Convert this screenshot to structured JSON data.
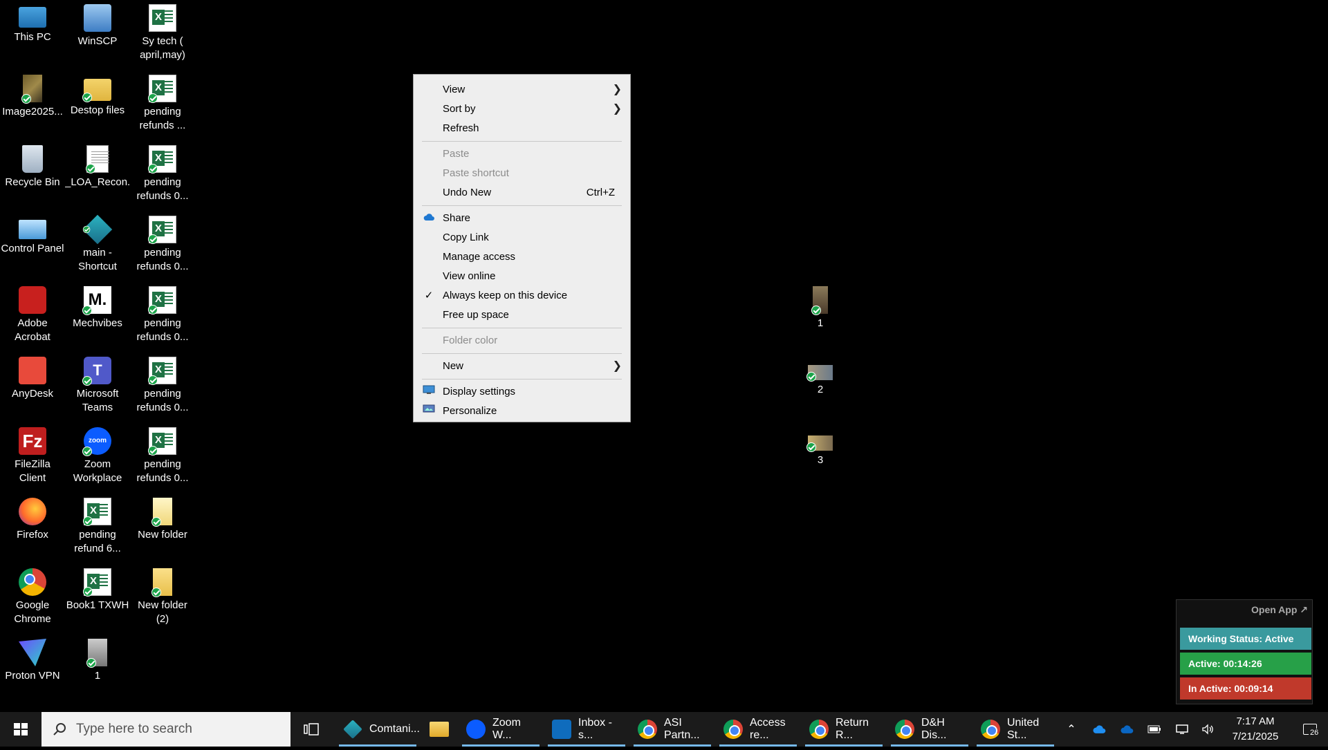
{
  "desktop": {
    "icons": [
      {
        "label": "This PC",
        "icon": "computer-icon"
      },
      {
        "label": "WinSCP",
        "icon": "winscp-icon"
      },
      {
        "label": "Sy tech ( april,may)",
        "icon": "excel-file-icon"
      },
      {
        "label": "Image2025...",
        "icon": "image-file-icon"
      },
      {
        "label": "Destop files",
        "icon": "folder-icon"
      },
      {
        "label": "pending refunds ...",
        "icon": "excel-file-icon"
      },
      {
        "label": "Recycle Bin",
        "icon": "recycle-bin-icon"
      },
      {
        "label": "_LOA_Recon...",
        "icon": "document-icon"
      },
      {
        "label": "pending refunds 0...",
        "icon": "excel-file-icon"
      },
      {
        "label": "Control Panel",
        "icon": "control-panel-icon"
      },
      {
        "label": "main - Shortcut",
        "icon": "shortcut-icon"
      },
      {
        "label": "pending refunds 0...",
        "icon": "excel-file-icon"
      },
      {
        "label": "Adobe Acrobat",
        "icon": "adobe-acrobat-icon"
      },
      {
        "label": "Mechvibes",
        "icon": "mechvibes-icon"
      },
      {
        "label": "pending refunds 0...",
        "icon": "excel-file-icon"
      },
      {
        "label": "AnyDesk",
        "icon": "anydesk-icon"
      },
      {
        "label": "Microsoft Teams",
        "icon": "teams-icon"
      },
      {
        "label": "pending refunds 0...",
        "icon": "excel-file-icon"
      },
      {
        "label": "FileZilla Client",
        "icon": "filezilla-icon"
      },
      {
        "label": "Zoom Workplace",
        "icon": "zoom-icon"
      },
      {
        "label": "pending refunds 0...",
        "icon": "excel-file-icon"
      },
      {
        "label": "Firefox",
        "icon": "firefox-icon"
      },
      {
        "label": "pending refund 6...",
        "icon": "excel-file-icon"
      },
      {
        "label": "New folder",
        "icon": "folder-icon"
      },
      {
        "label": "Google Chrome",
        "icon": "chrome-icon"
      },
      {
        "label": "Book1 TXWH",
        "icon": "excel-file-icon"
      },
      {
        "label": "New folder (2)",
        "icon": "folder-icon"
      },
      {
        "label": "Proton VPN",
        "icon": "proton-vpn-icon"
      },
      {
        "label": "1",
        "icon": "image-file-icon"
      }
    ],
    "floating_icons": [
      {
        "label": "1",
        "icon": "image-file-icon"
      },
      {
        "label": "2",
        "icon": "image-file-icon"
      },
      {
        "label": "3",
        "icon": "image-file-icon"
      }
    ]
  },
  "context_menu": {
    "view": "View",
    "sort_by": "Sort by",
    "refresh": "Refresh",
    "paste": "Paste",
    "paste_shortcut": "Paste shortcut",
    "undo_new": "Undo New",
    "undo_shortcut": "Ctrl+Z",
    "share": "Share",
    "copy_link": "Copy Link",
    "manage_access": "Manage access",
    "view_online": "View online",
    "always_keep": "Always keep on this device",
    "free_up_space": "Free up space",
    "folder_color": "Folder color",
    "new": "New",
    "display_settings": "Display settings",
    "personalize": "Personalize"
  },
  "widget": {
    "open_app": "Open App ↗",
    "working_status": "Working Status: Active",
    "active": "Active: 00:14:26",
    "inactive": "In Active: 00:09:14",
    "colors": {
      "status": "#3a9a9e",
      "active": "#27a048",
      "inactive": "#c0392b"
    }
  },
  "taskbar": {
    "search_placeholder": "Type here to search",
    "apps": [
      {
        "label": "Comtani...",
        "icon": "comtani-icon"
      },
      {
        "label": "",
        "icon": "file-explorer-icon"
      },
      {
        "label": "Zoom W...",
        "icon": "zoom-icon"
      },
      {
        "label": "Inbox - s...",
        "icon": "outlook-icon"
      },
      {
        "label": "ASI Partn...",
        "icon": "chrome-icon"
      },
      {
        "label": "Access re...",
        "icon": "chrome-icon"
      },
      {
        "label": "Return R...",
        "icon": "chrome-icon"
      },
      {
        "label": "D&H Dis...",
        "icon": "chrome-icon"
      },
      {
        "label": "United St...",
        "icon": "chrome-icon"
      }
    ],
    "time": "7:17 AM",
    "date": "7/21/2025",
    "notification_count": "26"
  }
}
